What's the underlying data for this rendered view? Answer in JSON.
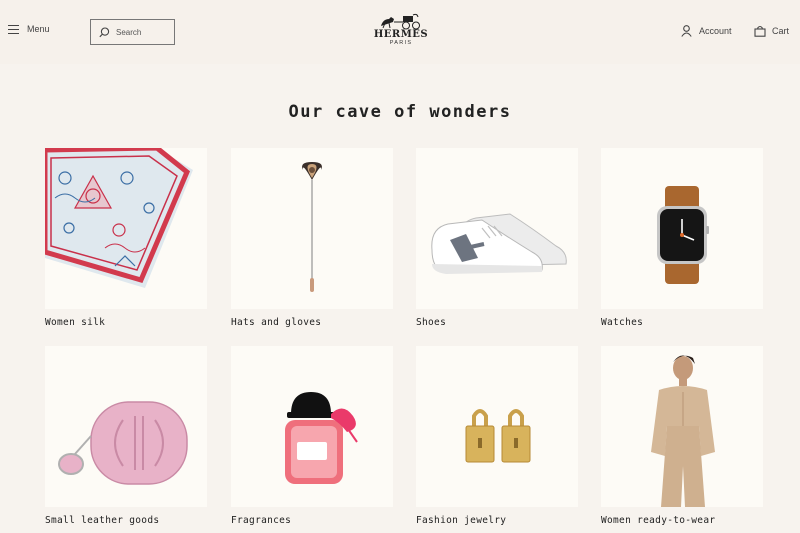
{
  "header": {
    "menu_label": "Menu",
    "search_placeholder": "Search",
    "logo_main": "HERMES",
    "logo_sub": "PARIS",
    "account_label": "Account",
    "cart_label": "Cart"
  },
  "main": {
    "title": "Our cave of wonders",
    "categories": [
      {
        "label": "Women silk",
        "icon": "silk-scarf-image"
      },
      {
        "label": "Hats and gloves",
        "icon": "hat-pin-image"
      },
      {
        "label": "Shoes",
        "icon": "sneaker-image"
      },
      {
        "label": "Watches",
        "icon": "watch-image"
      },
      {
        "label": "Small leather goods",
        "icon": "leather-pouch-image"
      },
      {
        "label": "Fragrances",
        "icon": "perfume-bottle-image"
      },
      {
        "label": "Fashion jewelry",
        "icon": "padlock-earrings-image"
      },
      {
        "label": "Women ready-to-wear",
        "icon": "model-outfit-image"
      }
    ]
  },
  "colors": {
    "background": "#f7f3ee",
    "card_background": "#fdfbf6",
    "text": "#222222"
  }
}
